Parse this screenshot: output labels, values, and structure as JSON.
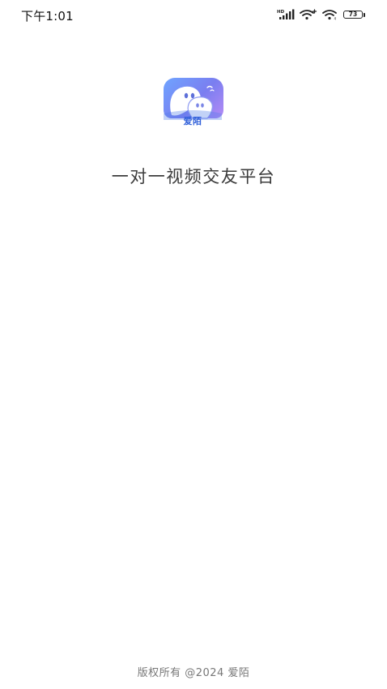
{
  "status_bar": {
    "time": "下午1:01",
    "battery": "73",
    "icons": [
      "hd-signal-icon",
      "wifi-plus-icon",
      "wifi-icon",
      "battery-icon"
    ]
  },
  "splash": {
    "logo_text": "爱陌",
    "slogan": "一对一视频交友平台"
  },
  "footer": {
    "copyright": "版权所有 @2024  爱陌"
  },
  "colors": {
    "logo_gradient_start": "#6fa4ff",
    "logo_gradient_end": "#b58bf5",
    "logo_text": "#2f5fd9",
    "slogan": "#3c3c3c",
    "footer": "#777777"
  }
}
